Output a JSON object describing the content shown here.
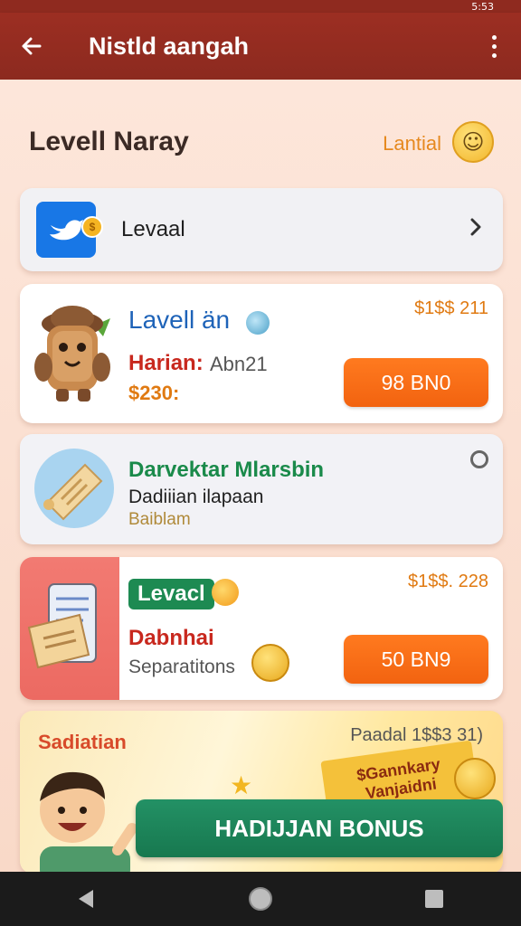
{
  "status_bar": {
    "right_text": "5:53"
  },
  "app_bar": {
    "title": "Nistld aangah"
  },
  "section": {
    "title": "Levell Naray",
    "link": "Lantial",
    "smiley": "☺"
  },
  "level_card": {
    "label": "Levaal",
    "coin": "$"
  },
  "offer1": {
    "title": "Lavell än",
    "subtitle": "Harian:",
    "subtitle_tail": "Abn21",
    "price": "$230:",
    "price_tail": "",
    "corner": "$1$$ 211",
    "button": "98 BN0"
  },
  "offer2": {
    "title": "Darvektar Mlarsbin",
    "line1": "Dadiiian ilapaan",
    "line2": "Baiblam"
  },
  "offer3": {
    "badge": "Levacl",
    "title": "Dabnhai",
    "subtitle": "Separatitons",
    "corner": "$1$$. 228",
    "button": "50 BN9"
  },
  "promo": {
    "heading": "Sadiatian",
    "corner": "Paadal 1$$3 31)",
    "banner_line1": "$Gannkary",
    "banner_line2": "Vanjaidni",
    "button": "HADIJJAN BONUS"
  },
  "icons": {
    "back": "back-arrow-icon",
    "more": "more-vert-icon",
    "chevron": "chevron-right-icon",
    "nav_back": "triangle-back-icon",
    "nav_home": "circle-home-icon",
    "nav_recent": "square-recent-icon"
  },
  "colors": {
    "app_bar": "#8f2a1f",
    "accent_orange": "#f26310",
    "accent_green": "#17784f",
    "title_blue": "#1e63b8",
    "title_green": "#1a8a4a",
    "red_text": "#c8281e",
    "gold_text": "#e07a12"
  }
}
